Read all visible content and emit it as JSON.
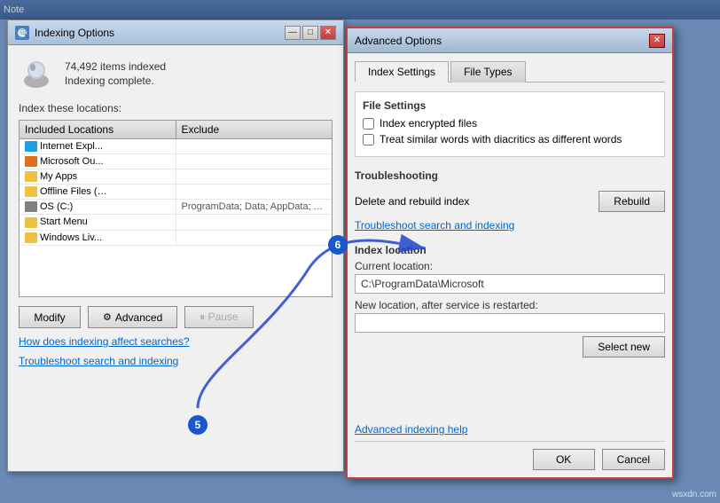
{
  "taskbar": {
    "note_label": "Note"
  },
  "indexing_window": {
    "title": "Indexing Options",
    "items_count": "74,492 items indexed",
    "status": "Indexing complete.",
    "index_locations_label": "Index these locations:",
    "table_headers": [
      "Included Locations",
      "Exclude"
    ],
    "locations": [
      {
        "name": "Internet Expl...",
        "icon": "ie",
        "exclude": ""
      },
      {
        "name": "Microsoft Ou...",
        "icon": "office",
        "exclude": ""
      },
      {
        "name": "My Apps",
        "icon": "folder",
        "exclude": ""
      },
      {
        "name": "Offline Files (…",
        "icon": "folder",
        "exclude": ""
      },
      {
        "name": "OS (C:)",
        "icon": "drive",
        "exclude": "ProgramData; Data; AppData; AppData; …"
      },
      {
        "name": "Start Menu",
        "icon": "folder",
        "exclude": ""
      },
      {
        "name": "Windows Liv...",
        "icon": "folder",
        "exclude": ""
      }
    ],
    "modify_btn": "Modify",
    "advanced_btn": "Advanced",
    "pause_btn": "⏸ Pause",
    "how_link": "How does indexing affect searches?",
    "troubleshoot_link": "Troubleshoot search and indexing"
  },
  "advanced_dialog": {
    "title": "Advanced Options",
    "tabs": [
      "Index Settings",
      "File Types"
    ],
    "file_settings_title": "File Settings",
    "checkbox_encrypted": "Index encrypted files",
    "checkbox_diacritics": "Treat similar words with diacritics as different words",
    "troubleshoot_title": "Troubleshooting",
    "delete_rebuild_label": "Delete and rebuild index",
    "rebuild_btn": "Rebuild",
    "troubleshoot_link": "Troubleshoot search and indexing",
    "index_location_title": "Index location",
    "current_location_label": "Current location:",
    "current_location_value": "C:\\ProgramData\\Microsoft",
    "new_location_label": "New location, after service is restarted:",
    "new_location_value": "",
    "select_new_btn": "Select new",
    "advanced_help_link": "Advanced indexing help",
    "ok_btn": "OK",
    "cancel_btn": "Cancel"
  },
  "steps": {
    "step5": "5",
    "step6": "6"
  },
  "watermark": "wsxdn.com"
}
